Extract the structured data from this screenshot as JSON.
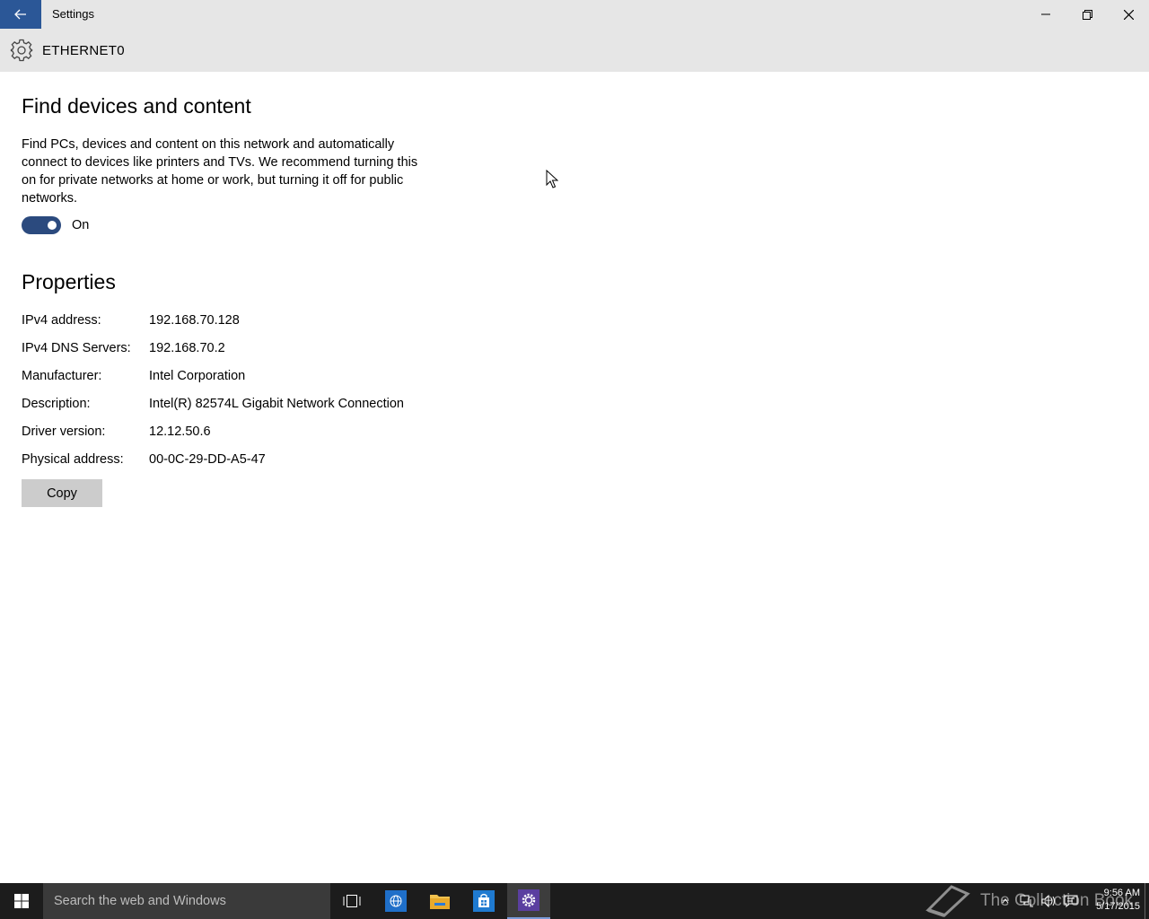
{
  "window": {
    "title": "Settings",
    "page_title": "ETHERNET0"
  },
  "network_discovery": {
    "heading": "Find devices and content",
    "description": "Find PCs, devices and content on this network and automatically connect to devices like printers and TVs. We recommend turning this on for private networks at home or work, but turning it off for public networks.",
    "toggle_state": "On",
    "toggle_on": true
  },
  "properties": {
    "heading": "Properties",
    "rows": [
      {
        "label": "IPv4 address:",
        "value": "192.168.70.128"
      },
      {
        "label": "IPv4 DNS Servers:",
        "value": "192.168.70.2"
      },
      {
        "label": "Manufacturer:",
        "value": "Intel Corporation"
      },
      {
        "label": "Description:",
        "value": "Intel(R) 82574L Gigabit Network Connection"
      },
      {
        "label": "Driver version:",
        "value": "12.12.50.6"
      },
      {
        "label": "Physical address:",
        "value": "00-0C-29-DD-A5-47"
      }
    ],
    "copy_label": "Copy"
  },
  "taskbar": {
    "search_placeholder": "Search the web and Windows",
    "watermark": "The Collection Book",
    "time": "9:56 AM",
    "date": "5/17/2015"
  },
  "colors": {
    "accent": "#2b5797",
    "toggle_on": "#2b4a7e",
    "titlebar": "#e6e6e6",
    "taskbar": "#1c1c1c"
  },
  "icons": {
    "back": "arrow-left-icon",
    "settings": "gear-icon",
    "minimize": "minimize-icon",
    "maximize": "restore-icon",
    "close": "close-icon"
  }
}
